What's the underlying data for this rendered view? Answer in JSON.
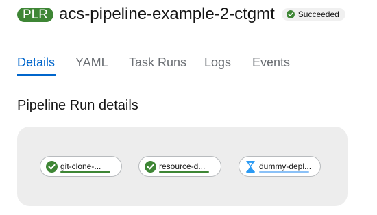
{
  "header": {
    "badge": "PLR",
    "title": "acs-pipeline-example-2-ctgmt",
    "status": "Succeeded"
  },
  "tabs": [
    {
      "label": "Details",
      "active": true
    },
    {
      "label": "YAML",
      "active": false
    },
    {
      "label": "Task Runs",
      "active": false
    },
    {
      "label": "Logs",
      "active": false
    },
    {
      "label": "Events",
      "active": false
    }
  ],
  "section": {
    "title": "Pipeline Run details"
  },
  "pipeline": {
    "tasks": [
      {
        "label": "git-clone-...",
        "status": "succeeded",
        "icon": "check-circle-icon"
      },
      {
        "label": "resource-d...",
        "status": "succeeded",
        "icon": "check-circle-icon"
      },
      {
        "label": "dummy-depl...",
        "status": "pending",
        "icon": "hourglass-icon"
      }
    ]
  },
  "colors": {
    "success": "#3e8635",
    "accent": "#0066cc",
    "pending_bar": "#8bc1f7",
    "pending_icon": "#2b9af3"
  }
}
